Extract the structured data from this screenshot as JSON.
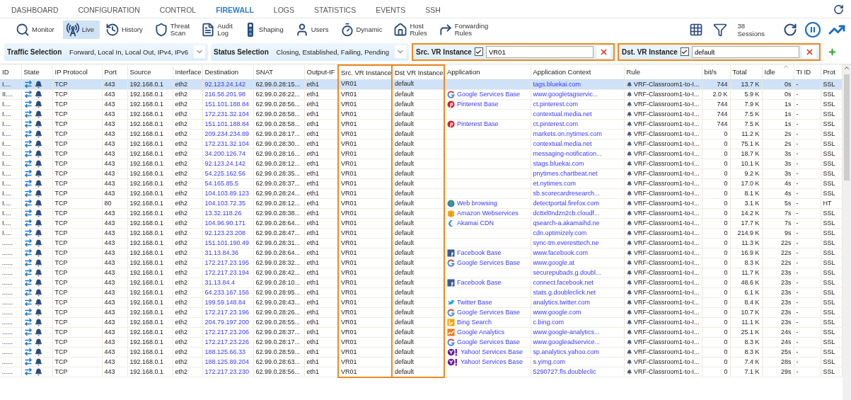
{
  "nav_tabs": [
    {
      "label": "DASHBOARD",
      "selected": false
    },
    {
      "label": "CONFIGURATION",
      "selected": false
    },
    {
      "label": "CONTROL",
      "selected": false
    },
    {
      "label": "FIREWALL",
      "selected": true
    },
    {
      "label": "LOGS",
      "selected": false
    },
    {
      "label": "STATISTICS",
      "selected": false
    },
    {
      "label": "EVENTS",
      "selected": false
    },
    {
      "label": "SSH",
      "selected": false
    }
  ],
  "toolbar": {
    "tools": [
      {
        "kind": "monitor",
        "lines": [
          "Monitor"
        ],
        "selected": false
      },
      {
        "kind": "live",
        "lines": [
          "Live"
        ],
        "selected": true
      },
      {
        "kind": "history",
        "lines": [
          "History"
        ],
        "selected": false
      },
      {
        "kind": "threat",
        "lines": [
          "Threat",
          "Scan"
        ],
        "selected": false
      },
      {
        "kind": "audit",
        "lines": [
          "Audit",
          "Log"
        ],
        "selected": false
      },
      {
        "kind": "shaping",
        "lines": [
          "Shaping"
        ],
        "selected": false
      },
      {
        "kind": "users",
        "lines": [
          "Users"
        ],
        "selected": false
      },
      {
        "kind": "dynamic",
        "lines": [
          "Dynamic"
        ],
        "selected": false
      },
      {
        "kind": "host",
        "lines": [
          "Host",
          "Rules"
        ],
        "selected": false
      },
      {
        "kind": "forwarding",
        "lines": [
          "Forwarding",
          "Rules"
        ],
        "selected": false
      }
    ],
    "sessions": {
      "count": "38",
      "label": "Sessions"
    }
  },
  "filters": {
    "selections": [
      {
        "label": "Traffic Selection",
        "value": "Forward, Local In, Local Out, IPv4, IPv6"
      },
      {
        "label": "Status Selection",
        "value": "Closing, Established, Failing, Pending"
      }
    ],
    "vr_filters": [
      {
        "label": "Src. VR Instance",
        "checked": true,
        "value": "VR01"
      },
      {
        "label": "Dst. VR Instance",
        "checked": true,
        "value": "default"
      }
    ]
  },
  "table": {
    "columns": [
      {
        "label": "ID",
        "highlighted": false,
        "sorted": false
      },
      {
        "label": "State",
        "highlighted": false,
        "sorted": false
      },
      {
        "label": "IP Protocol",
        "highlighted": false,
        "sorted": false
      },
      {
        "label": "Port",
        "highlighted": false,
        "sorted": false
      },
      {
        "label": "Source",
        "highlighted": false,
        "sorted": false
      },
      {
        "label": "Interface",
        "highlighted": false,
        "sorted": false
      },
      {
        "label": "Destination",
        "highlighted": false,
        "sorted": false
      },
      {
        "label": "SNAT",
        "highlighted": false,
        "sorted": false
      },
      {
        "label": "Output-IF",
        "highlighted": false,
        "sorted": false
      },
      {
        "label": "Src. VR Instance",
        "highlighted": true,
        "sorted": false
      },
      {
        "label": "Dst VR Instance",
        "highlighted": true,
        "sorted": false
      },
      {
        "label": "Application",
        "highlighted": false,
        "sorted": false
      },
      {
        "label": "Application Context",
        "highlighted": false,
        "sorted": false
      },
      {
        "label": "Rule",
        "highlighted": false,
        "sorted": false
      },
      {
        "label": "bit/s",
        "highlighted": false,
        "sorted": false
      },
      {
        "label": "Total",
        "highlighted": false,
        "sorted": false
      },
      {
        "label": "Idle",
        "highlighted": false,
        "sorted": true
      },
      {
        "label": "TI ID",
        "highlighted": false,
        "sorted": false
      },
      {
        "label": "Prot",
        "highlighted": false,
        "sorted": false
      }
    ],
    "rows": [
      {
        "selected": true,
        "id": "I....",
        "protocol": "TCP",
        "port": "443",
        "source": "192.168.0.1",
        "interface": "eth2",
        "destination": "92.123.24.142",
        "snat": "62.99.0.28:15...",
        "output_if": "eth1",
        "src_vr": "VR01",
        "dst_vr": "default",
        "context": "tags.bluekai.com",
        "rule": "VRF-Classroom1-to-I...",
        "bits": "744",
        "total": "13.7 K",
        "idle": "0s",
        "ti_id": "-",
        "prot": "SSL"
      },
      {
        "selected": false,
        "id": "II....",
        "protocol": "TCP",
        "port": "443",
        "source": "192.168.0.1",
        "interface": "eth2",
        "destination": "216.58.201.98",
        "snat": "62.99.0.28:22...",
        "output_if": "eth1",
        "src_vr": "VR01",
        "dst_vr": "default",
        "app": {
          "kind": "google",
          "name": "Google Services Base"
        },
        "context": "www.googletagservic...",
        "rule": "VRF-Classroom1-to-I...",
        "bits": "2.0 K",
        "total": "5.9 K",
        "idle": "0s",
        "ti_id": "-",
        "prot": "SSL"
      },
      {
        "selected": false,
        "id": "I....",
        "protocol": "TCP",
        "port": "443",
        "source": "192.168.0.1",
        "interface": "eth2",
        "destination": "151.101.188.84",
        "snat": "62.99.0.28:56...",
        "output_if": "eth1",
        "src_vr": "VR01",
        "dst_vr": "default",
        "app": {
          "kind": "pinterest",
          "name": "Pinterest Base"
        },
        "context": "ct.pinterest.com",
        "rule": "VRF-Classroom1-to-I...",
        "bits": "744",
        "total": "7.9 K",
        "idle": "1s",
        "ti_id": "-",
        "prot": "SSL"
      },
      {
        "selected": false,
        "id": "I....",
        "protocol": "TCP",
        "port": "443",
        "source": "192.168.0.1",
        "interface": "eth2",
        "destination": "172.231.32.104",
        "snat": "62.99.0.28:58...",
        "output_if": "eth1",
        "src_vr": "VR01",
        "dst_vr": "default",
        "context": "contextual.media.net",
        "rule": "VRF-Classroom1-to-I...",
        "bits": "744",
        "total": "7.5 K",
        "idle": "1s",
        "ti_id": "-",
        "prot": "SSL"
      },
      {
        "selected": false,
        "id": "I....",
        "protocol": "TCP",
        "port": "443",
        "source": "192.168.0.1",
        "interface": "eth2",
        "destination": "151.101.188.84",
        "snat": "62.99.0.28:58...",
        "output_if": "eth1",
        "src_vr": "VR01",
        "dst_vr": "default",
        "app": {
          "kind": "pinterest",
          "name": "Pinterest Base"
        },
        "context": "ct.pinterest.com",
        "rule": "VRF-Classroom1-to-I...",
        "bits": "744",
        "total": "7.5 K",
        "idle": "1s",
        "ti_id": "-",
        "prot": "SSL"
      },
      {
        "selected": false,
        "id": "I....",
        "protocol": "TCP",
        "port": "443",
        "source": "192.168.0.1",
        "interface": "eth2",
        "destination": "209.234.234.89",
        "snat": "62.99.0.28:17...",
        "output_if": "eth1",
        "src_vr": "VR01",
        "dst_vr": "default",
        "context": "markets.on.nytimes.com",
        "rule": "VRF-Classroom1-to-I...",
        "bits": "0",
        "total": "11.2 K",
        "idle": "2s",
        "ti_id": "-",
        "prot": "SSL"
      },
      {
        "selected": false,
        "id": "I....",
        "protocol": "TCP",
        "port": "443",
        "source": "192.168.0.1",
        "interface": "eth2",
        "destination": "172.231.32.104",
        "snat": "62.99.0.28:30...",
        "output_if": "eth1",
        "src_vr": "VR01",
        "dst_vr": "default",
        "context": "contextual.media.net",
        "rule": "VRF-Classroom1-to-I...",
        "bits": "0",
        "total": "75.1 K",
        "idle": "2s",
        "ti_id": "-",
        "prot": "SSL"
      },
      {
        "selected": false,
        "id": "I....",
        "protocol": "TCP",
        "port": "443",
        "source": "192.168.0.1",
        "interface": "eth2",
        "destination": "34.200.126.74",
        "snat": "62.99.0.28:16...",
        "output_if": "eth1",
        "src_vr": "VR01",
        "dst_vr": "default",
        "context": "messaging-notification...",
        "rule": "VRF-Classroom1-to-I...",
        "bits": "0",
        "total": "18.7 K",
        "idle": "3s",
        "ti_id": "-",
        "prot": "SSL"
      },
      {
        "selected": false,
        "id": "I....",
        "protocol": "TCP",
        "port": "443",
        "source": "192.168.0.1",
        "interface": "eth2",
        "destination": "92.123.24.142",
        "snat": "62.99.0.28:12...",
        "output_if": "eth1",
        "src_vr": "VR01",
        "dst_vr": "default",
        "context": "stags.bluekai.com",
        "rule": "VRF-Classroom1-to-I...",
        "bits": "0",
        "total": "10.1 K",
        "idle": "3s",
        "ti_id": "-",
        "prot": "SSL"
      },
      {
        "selected": false,
        "id": "I....",
        "protocol": "TCP",
        "port": "443",
        "source": "192.168.0.1",
        "interface": "eth2",
        "destination": "54.225.162.56",
        "snat": "62.99.0.28:35...",
        "output_if": "eth1",
        "src_vr": "VR01",
        "dst_vr": "default",
        "context": "pnytimes.chartbeat.net",
        "rule": "VRF-Classroom1-to-I...",
        "bits": "0",
        "total": "9.2 K",
        "idle": "3s",
        "ti_id": "-",
        "prot": "SSL"
      },
      {
        "selected": false,
        "id": "I....",
        "protocol": "TCP",
        "port": "443",
        "source": "192.168.0.1",
        "interface": "eth2",
        "destination": "54.165.85.5",
        "snat": "62.99.0.28:37...",
        "output_if": "eth1",
        "src_vr": "VR01",
        "dst_vr": "default",
        "context": "et.nytimes.com",
        "rule": "VRF-Classroom1-to-I...",
        "bits": "0",
        "total": "17.0 K",
        "idle": "4s",
        "ti_id": "-",
        "prot": "SSL"
      },
      {
        "selected": false,
        "id": "I....",
        "protocol": "TCP",
        "port": "443",
        "source": "192.168.0.1",
        "interface": "eth2",
        "destination": "104.103.89.123",
        "snat": "62.99.0.28:24...",
        "output_if": "eth1",
        "src_vr": "VR01",
        "dst_vr": "default",
        "context": "sb.scorecardresearch...",
        "rule": "VRF-Classroom1-to-I...",
        "bits": "0",
        "total": "8.1 K",
        "idle": "4s",
        "ti_id": "-",
        "prot": "SSL"
      },
      {
        "selected": false,
        "id": "I....",
        "protocol": "TCP",
        "port": "80",
        "source": "192.168.0.1",
        "interface": "eth2",
        "destination": "104.103.72.35",
        "snat": "62.99.0.28:12...",
        "output_if": "eth1",
        "src_vr": "VR01",
        "dst_vr": "default",
        "app": {
          "kind": "web",
          "name": "Web browsing"
        },
        "context": "detectportal.firefox.com",
        "rule": "VRF-Classroom1-to-I...",
        "bits": "0",
        "total": "3.1 K",
        "idle": "5s",
        "ti_id": "-",
        "prot": "HT"
      },
      {
        "selected": false,
        "id": "I....",
        "protocol": "TCP",
        "port": "443",
        "source": "192.168.0.1",
        "interface": "eth2",
        "destination": "13.32.118.26",
        "snat": "62.99.0.28:38...",
        "output_if": "eth1",
        "src_vr": "VR01",
        "dst_vr": "default",
        "app": {
          "kind": "amazon",
          "name": "Amazon Webservices"
        },
        "context": "dc8xl0ndzn2cb.cloudf...",
        "rule": "VRF-Classroom1-to-I...",
        "bits": "0",
        "total": "14.2 K",
        "idle": "7s",
        "ti_id": "-",
        "prot": "SSL"
      },
      {
        "selected": false,
        "id": "I....",
        "protocol": "TCP",
        "port": "443",
        "source": "192.168.0.1",
        "interface": "eth2",
        "destination": "104.96.90.171",
        "snat": "62.99.0.28:64...",
        "output_if": "eth1",
        "src_vr": "VR01",
        "dst_vr": "default",
        "app": {
          "kind": "akamai",
          "name": "Akamai CDN"
        },
        "context": "qsearch-a.akamaihd.ne",
        "rule": "VRF-Classroom1-to-I...",
        "bits": "0",
        "total": "17.7 K",
        "idle": "7s",
        "ti_id": "-",
        "prot": "SSL"
      },
      {
        "selected": false,
        "id": "I....",
        "protocol": "TCP",
        "port": "443",
        "source": "192.168.0.1",
        "interface": "eth2",
        "destination": "92.123.23.208",
        "snat": "62.99.0.28:47...",
        "output_if": "eth1",
        "src_vr": "VR01",
        "dst_vr": "default",
        "context": "cdn.optimizely.com",
        "rule": "VRF-Classroom1-to-I...",
        "bits": "0",
        "total": "214.9 K",
        "idle": "9s",
        "ti_id": "-",
        "prot": "SSL"
      },
      {
        "selected": false,
        "id": "......",
        "protocol": "TCP",
        "port": "443",
        "source": "192.168.0.1",
        "interface": "eth2",
        "destination": "151.101.190.49",
        "snat": "62.99.0.28:31...",
        "output_if": "eth1",
        "src_vr": "VR01",
        "dst_vr": "default",
        "context": "sync-tm.everesttech.ne",
        "rule": "VRF-Classroom1-to-I...",
        "bits": "0",
        "total": "11.3 K",
        "idle": "22s",
        "ti_id": "-",
        "prot": "SSL"
      },
      {
        "selected": false,
        "id": "......",
        "protocol": "TCP",
        "port": "443",
        "source": "192.168.0.1",
        "interface": "eth2",
        "destination": "31.13.84.36",
        "snat": "62.99.0.28:64...",
        "output_if": "eth1",
        "src_vr": "VR01",
        "dst_vr": "default",
        "app": {
          "kind": "facebook",
          "name": "Facebook Base"
        },
        "context": "www.facebook.com",
        "rule": "VRF-Classroom1-to-I...",
        "bits": "0",
        "total": "16.9 K",
        "idle": "22s",
        "ti_id": "-",
        "prot": "SSL"
      },
      {
        "selected": false,
        "id": "......",
        "protocol": "TCP",
        "port": "443",
        "source": "192.168.0.1",
        "interface": "eth2",
        "destination": "172.217.23.195",
        "snat": "62.99.0.28:32...",
        "output_if": "eth1",
        "src_vr": "VR01",
        "dst_vr": "default",
        "app": {
          "kind": "google",
          "name": "Google Services Base"
        },
        "context": "www.google.at",
        "rule": "VRF-Classroom1-to-I...",
        "bits": "0",
        "total": "8.3 K",
        "idle": "22s",
        "ti_id": "-",
        "prot": "SSL"
      },
      {
        "selected": false,
        "id": "......",
        "protocol": "TCP",
        "port": "443",
        "source": "192.168.0.1",
        "interface": "eth2",
        "destination": "172.217.23.194",
        "snat": "62.99.0.28:42...",
        "output_if": "eth1",
        "src_vr": "VR01",
        "dst_vr": "default",
        "context": "securepubads.g.doubl...",
        "rule": "VRF-Classroom1-to-I...",
        "bits": "0",
        "total": "11.7 K",
        "idle": "23s",
        "ti_id": "-",
        "prot": "SSL"
      },
      {
        "selected": false,
        "id": "......",
        "protocol": "TCP",
        "port": "443",
        "source": "192.168.0.1",
        "interface": "eth2",
        "destination": "31.13.84.4",
        "snat": "62.99.0.28:10...",
        "output_if": "eth1",
        "src_vr": "VR01",
        "dst_vr": "default",
        "app": {
          "kind": "facebook",
          "name": "Facebook Base"
        },
        "context": "connect.facebook.net",
        "rule": "VRF-Classroom1-to-I...",
        "bits": "0",
        "total": "48.6 K",
        "idle": "23s",
        "ti_id": "-",
        "prot": "SSL"
      },
      {
        "selected": false,
        "id": "......",
        "protocol": "TCP",
        "port": "443",
        "source": "192.168.0.1",
        "interface": "eth2",
        "destination": "64.233.167.156",
        "snat": "62.99.0.28:95...",
        "output_if": "eth1",
        "src_vr": "VR01",
        "dst_vr": "default",
        "context": "stats.g.doubleclick.net",
        "rule": "VRF-Classroom1-to-I...",
        "bits": "0",
        "total": "6.1 K",
        "idle": "23s",
        "ti_id": "-",
        "prot": "SSL"
      },
      {
        "selected": false,
        "id": "......",
        "protocol": "TCP",
        "port": "443",
        "source": "192.168.0.1",
        "interface": "eth2",
        "destination": "199.59.148.84",
        "snat": "62.99.0.28:43...",
        "output_if": "eth1",
        "src_vr": "VR01",
        "dst_vr": "default",
        "app": {
          "kind": "twitter",
          "name": "Twitter Base"
        },
        "context": "analytics.twitter.com",
        "rule": "VRF-Classroom1-to-I...",
        "bits": "0",
        "total": "8.4 K",
        "idle": "23s",
        "ti_id": "-",
        "prot": "SSL"
      },
      {
        "selected": false,
        "id": "......",
        "protocol": "TCP",
        "port": "443",
        "source": "192.168.0.1",
        "interface": "eth2",
        "destination": "172.217.23.196",
        "snat": "62.99.0.28:26...",
        "output_if": "eth1",
        "src_vr": "VR01",
        "dst_vr": "default",
        "app": {
          "kind": "google",
          "name": "Google Services Base"
        },
        "context": "www.google.com",
        "rule": "VRF-Classroom1-to-I...",
        "bits": "0",
        "total": "10.7 K",
        "idle": "23s",
        "ti_id": "-",
        "prot": "SSL"
      },
      {
        "selected": false,
        "id": "......",
        "protocol": "TCP",
        "port": "443",
        "source": "192.168.0.1",
        "interface": "eth2",
        "destination": "204.79.197.200",
        "snat": "62.99.0.28:55...",
        "output_if": "eth1",
        "src_vr": "VR01",
        "dst_vr": "default",
        "app": {
          "kind": "bing",
          "name": "Bing Search"
        },
        "context": "c.bing.com",
        "rule": "VRF-Classroom1-to-I...",
        "bits": "0",
        "total": "11.1 K",
        "idle": "23s",
        "ti_id": "-",
        "prot": "SSL"
      },
      {
        "selected": false,
        "id": "......",
        "protocol": "TCP",
        "port": "443",
        "source": "192.168.0.1",
        "interface": "eth2",
        "destination": "172.217.23.206",
        "snat": "62.99.0.28:37...",
        "output_if": "eth1",
        "src_vr": "VR01",
        "dst_vr": "default",
        "app": {
          "kind": "analytics",
          "name": "Google Analytics"
        },
        "context": "www.google-analytics...",
        "rule": "VRF-Classroom1-to-I...",
        "bits": "0",
        "total": "25.1 K",
        "idle": "24s",
        "ti_id": "-",
        "prot": "SSL"
      },
      {
        "selected": false,
        "id": "......",
        "protocol": "TCP",
        "port": "443",
        "source": "192.168.0.1",
        "interface": "eth2",
        "destination": "172.217.23.226",
        "snat": "62.99.0.28:17...",
        "output_if": "eth1",
        "src_vr": "VR01",
        "dst_vr": "default",
        "app": {
          "kind": "google",
          "name": "Google Services Base"
        },
        "context": "www.googleadservice...",
        "rule": "VRF-Classroom1-to-I...",
        "bits": "0",
        "total": "8.3 K",
        "idle": "24s",
        "ti_id": "-",
        "prot": "SSL"
      },
      {
        "selected": false,
        "id": "......",
        "protocol": "TCP",
        "port": "443",
        "source": "192.168.0.1",
        "interface": "eth2",
        "destination": "188.125.66.33",
        "snat": "62.99.0.28:59...",
        "output_if": "eth1",
        "src_vr": "VR01",
        "dst_vr": "default",
        "app": {
          "kind": "yahoo",
          "name": "Yahoo! Services Base"
        },
        "context": "sp.analytics.yahoo.com",
        "rule": "VRF-Classroom1-to-I...",
        "bits": "0",
        "total": "8.3 K",
        "idle": "25s",
        "ti_id": "-",
        "prot": "SSL"
      },
      {
        "selected": false,
        "id": "......",
        "protocol": "TCP",
        "port": "443",
        "source": "192.168.0.1",
        "interface": "eth2",
        "destination": "188.125.89.204",
        "snat": "62.99.0.28:63...",
        "output_if": "eth1",
        "src_vr": "VR01",
        "dst_vr": "default",
        "app": {
          "kind": "yahoo",
          "name": "Yahoo! Services Base"
        },
        "context": "s.yimg.com",
        "rule": "VRF-Classroom1-to-I...",
        "bits": "0",
        "total": "7.4 K",
        "idle": "28s",
        "ti_id": "-",
        "prot": "SSL"
      },
      {
        "selected": false,
        "id": "......",
        "protocol": "TCP",
        "port": "443",
        "source": "192.168.0.1",
        "interface": "eth2",
        "destination": "172.217.23.230",
        "snat": "62.99.0.28:56...",
        "output_if": "eth1",
        "src_vr": "VR01",
        "dst_vr": "default",
        "context": "5290727.fls.doubleclic",
        "rule": "VRF-Classroom1-to-I...",
        "bits": "0",
        "total": "7.1 K",
        "idle": "29s",
        "ti_id": "-",
        "prot": "SSL"
      }
    ]
  }
}
